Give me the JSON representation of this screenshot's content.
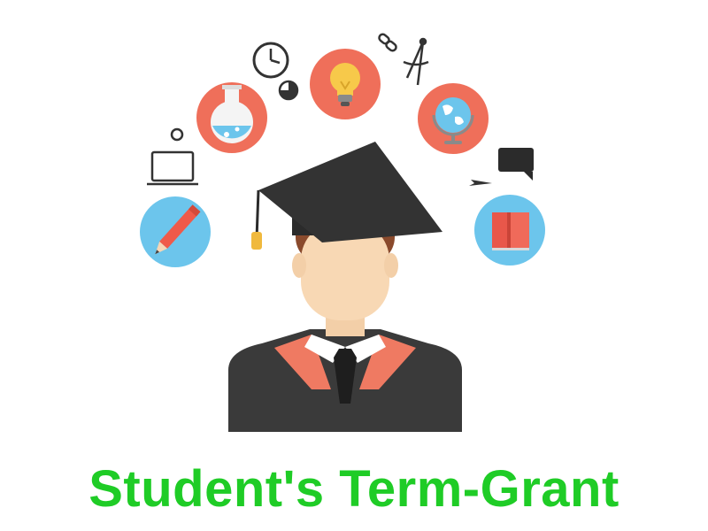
{
  "title": "Student's Term-Grant",
  "colors": {
    "title": "#1fcc26",
    "salmon": "#ef6f5a",
    "sky_blue": "#6cc5ec",
    "gown": "#3a3a3a",
    "cap": "#2b2b2b",
    "skin": "#f8d8b4",
    "hair": "#8a4a2c",
    "tassel": "#f0b93e",
    "collar_trim": "#ef7a62"
  },
  "icons": [
    "pencil-icon",
    "laptop-icon",
    "flask-icon",
    "clock-icon",
    "pie-chart-icon",
    "lightbulb-icon",
    "chain-link-icon",
    "compass-tool-icon",
    "globe-icon",
    "paper-plane-icon",
    "speech-bubble-icon",
    "book-icon"
  ]
}
